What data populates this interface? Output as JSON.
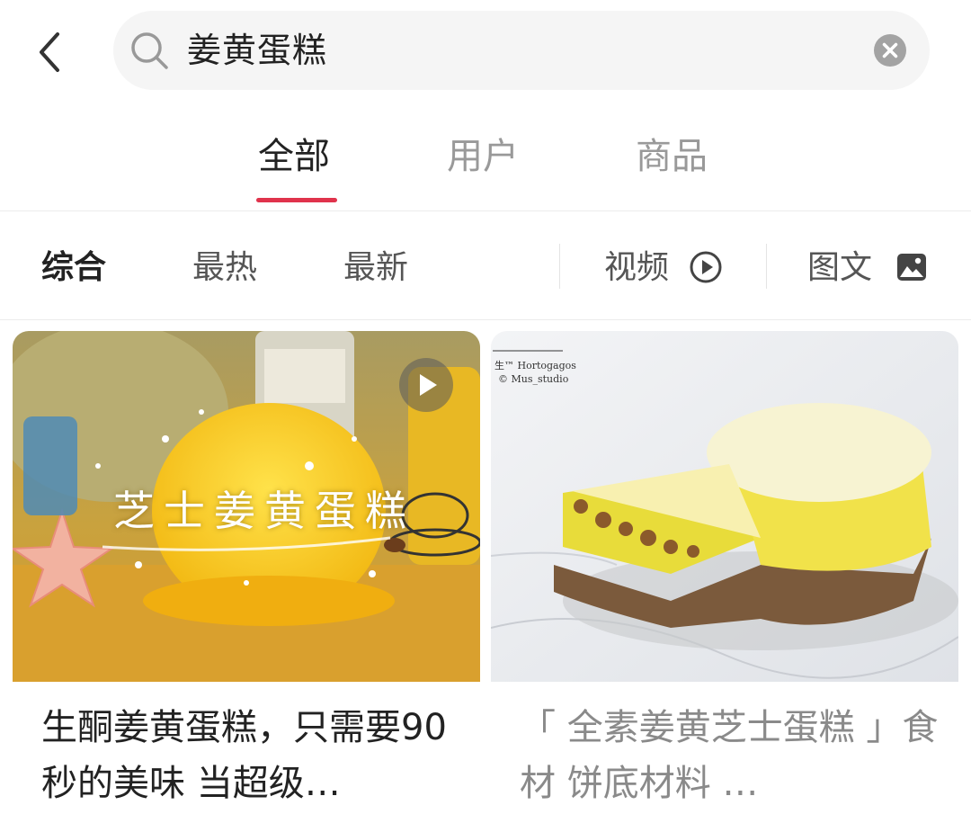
{
  "search": {
    "query": "姜黄蛋糕"
  },
  "main_tabs": [
    {
      "label": "全部",
      "active": true
    },
    {
      "label": "用户",
      "active": false
    },
    {
      "label": "商品",
      "active": false
    }
  ],
  "filters": {
    "sort": [
      {
        "label": "综合",
        "active": true
      },
      {
        "label": "最热",
        "active": false
      },
      {
        "label": "最新",
        "active": false
      }
    ],
    "video_label": "视频",
    "image_text_label": "图文"
  },
  "cards": [
    {
      "title": "生酮姜黄蛋糕，只需要90秒的美味 当超级…",
      "overlay_text": "芝士姜黄蛋糕",
      "has_video": true
    },
    {
      "title": "「 全素姜黄芝士蛋糕 」食材 饼底材料 …",
      "watermark_line1": "生™ Hortogagos",
      "watermark_line2": "© Mus_studio",
      "has_video": false
    }
  ],
  "colors": {
    "accent": "#e0334c",
    "search_bg": "#f5f5f5",
    "muted_text": "#999999"
  },
  "icons": {
    "back": "chevron-left-icon",
    "search": "search-icon",
    "clear": "clear-circle-icon",
    "video": "play-circle-icon",
    "image": "image-icon",
    "play": "play-icon"
  }
}
